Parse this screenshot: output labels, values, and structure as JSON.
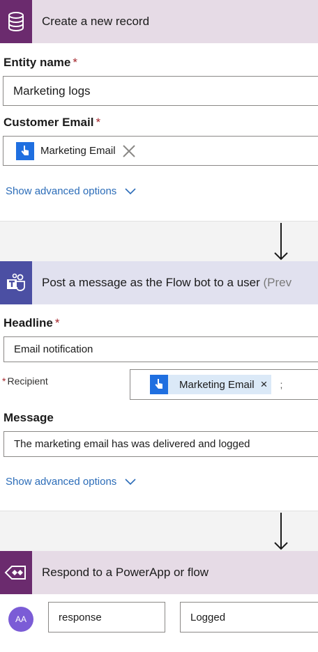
{
  "colors": {
    "record_header": "#e6dbe6",
    "record_icon": "#6b2b6e",
    "teams_header": "#e1e1ef",
    "teams_icon": "#4b4fa3",
    "powerapp_header": "#e6dbe6",
    "powerapp_icon": "#6b2b6e",
    "token": "#dbe9f7",
    "token_icon": "#1f6fe0",
    "link": "#2b6cb8"
  },
  "card1": {
    "title": "Create a new record",
    "icon": "database-icon",
    "entity_label": "Entity name",
    "entity_value": "Marketing logs",
    "email_label": "Customer Email",
    "email_token": "Marketing Email",
    "advanced": "Show advanced options"
  },
  "card2": {
    "title": "Post a message as the Flow bot to a user",
    "title_suffix": "(Prev",
    "icon": "teams-icon",
    "headline_label": "Headline",
    "headline_value": "Email notification",
    "recipient_label": "Recipient",
    "recipient_token": "Marketing Email",
    "recipient_close": "×",
    "recipient_sep": ";",
    "message_label": "Message",
    "message_value": "The marketing email has was delivered and logged",
    "advanced": "Show advanced options"
  },
  "card3": {
    "title": "Respond to a PowerApp or flow",
    "icon": "powerapps-icon",
    "avatar": "AA",
    "output_name": "response",
    "output_value": "Logged"
  },
  "required_mark": "*"
}
